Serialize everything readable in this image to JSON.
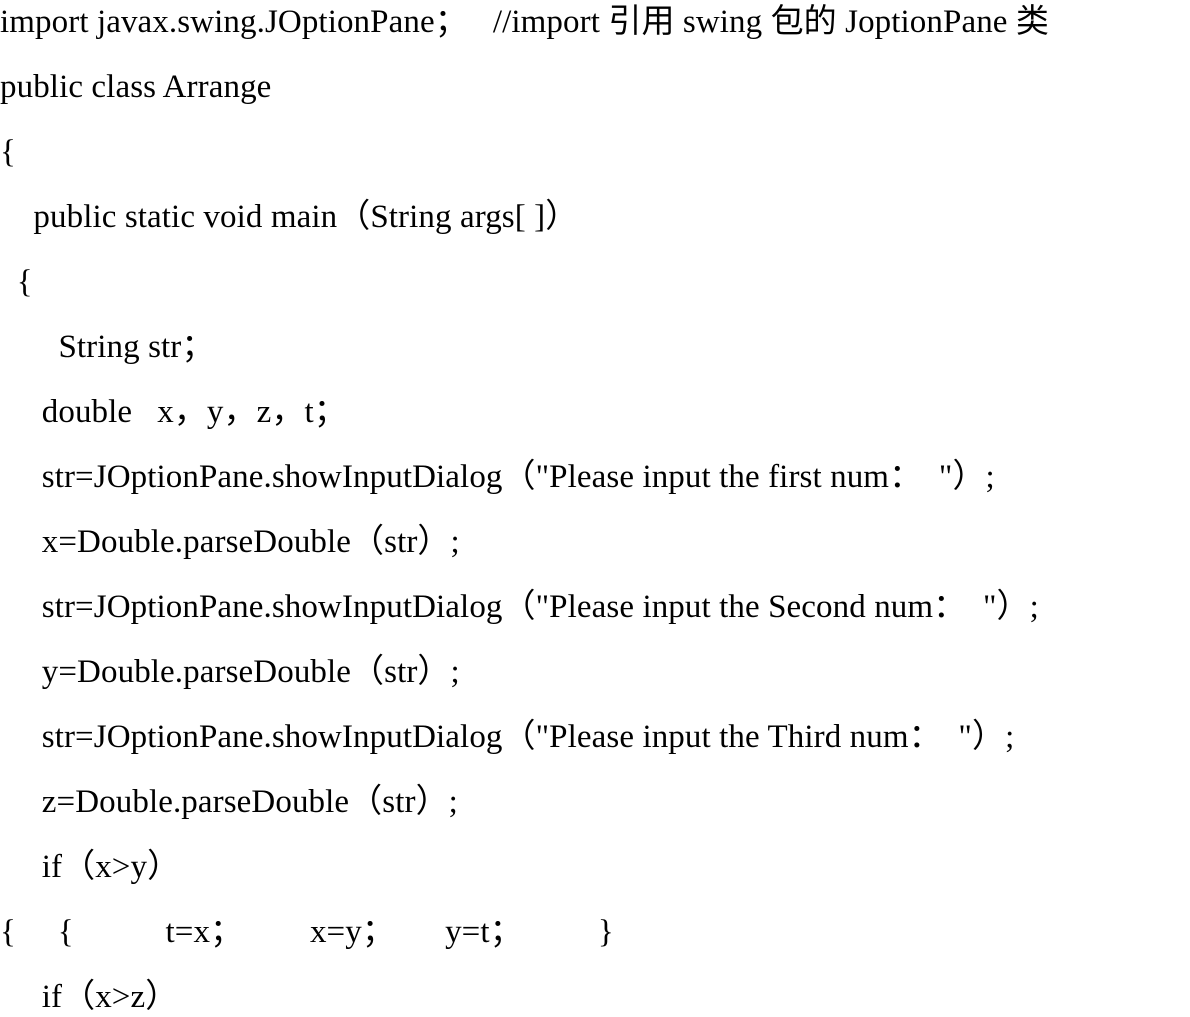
{
  "document": {
    "kind": "java-source-code-listing",
    "background_color": "#ffffff",
    "text_color": "#000000",
    "lines": [
      {
        "id": "line-import",
        "indent": 0,
        "text": "import javax.swing.JOptionPane；   //import 引用 swing 包的 JoptionPane 类"
      },
      {
        "id": "line-class-decl",
        "indent": 0,
        "text": "public class Arrange"
      },
      {
        "id": "line-class-open-brace",
        "indent": 0,
        "text": "{"
      },
      {
        "id": "line-main-decl",
        "indent": 1,
        "text": "    public static void main（String args[ ]）"
      },
      {
        "id": "line-main-open-brace",
        "indent": 1,
        "text": "  {"
      },
      {
        "id": "line-decl-string",
        "indent": 2,
        "text": "       String str；"
      },
      {
        "id": "line-decl-double",
        "indent": 2,
        "text": "     double   x，y，z，t；"
      },
      {
        "id": "line-input-first",
        "indent": 2,
        "text": "     str=JOptionPane.showInputDialog（\"Please input the first num：  \"）;"
      },
      {
        "id": "line-parse-x",
        "indent": 2,
        "text": "     x=Double.parseDouble（str）;"
      },
      {
        "id": "line-input-second",
        "indent": 2,
        "text": "     str=JOptionPane.showInputDialog（\"Please input the Second num：  \"）;"
      },
      {
        "id": "line-parse-y",
        "indent": 2,
        "text": "     y=Double.parseDouble（str）;"
      },
      {
        "id": "line-input-third",
        "indent": 2,
        "text": "     str=JOptionPane.showInputDialog（\"Please input the Third num：  \"）;"
      },
      {
        "id": "line-parse-z",
        "indent": 2,
        "text": "     z=Double.parseDouble（str）;"
      },
      {
        "id": "line-if-x-gt-y",
        "indent": 2,
        "text": "     if（x>y）"
      },
      {
        "id": "line-swap-block",
        "indent": 0,
        "text": "{     {           t=x；        x=y；      y=t；         }"
      },
      {
        "id": "line-if-x-gt-z",
        "indent": 2,
        "text": "     if（x>z）"
      }
    ]
  }
}
